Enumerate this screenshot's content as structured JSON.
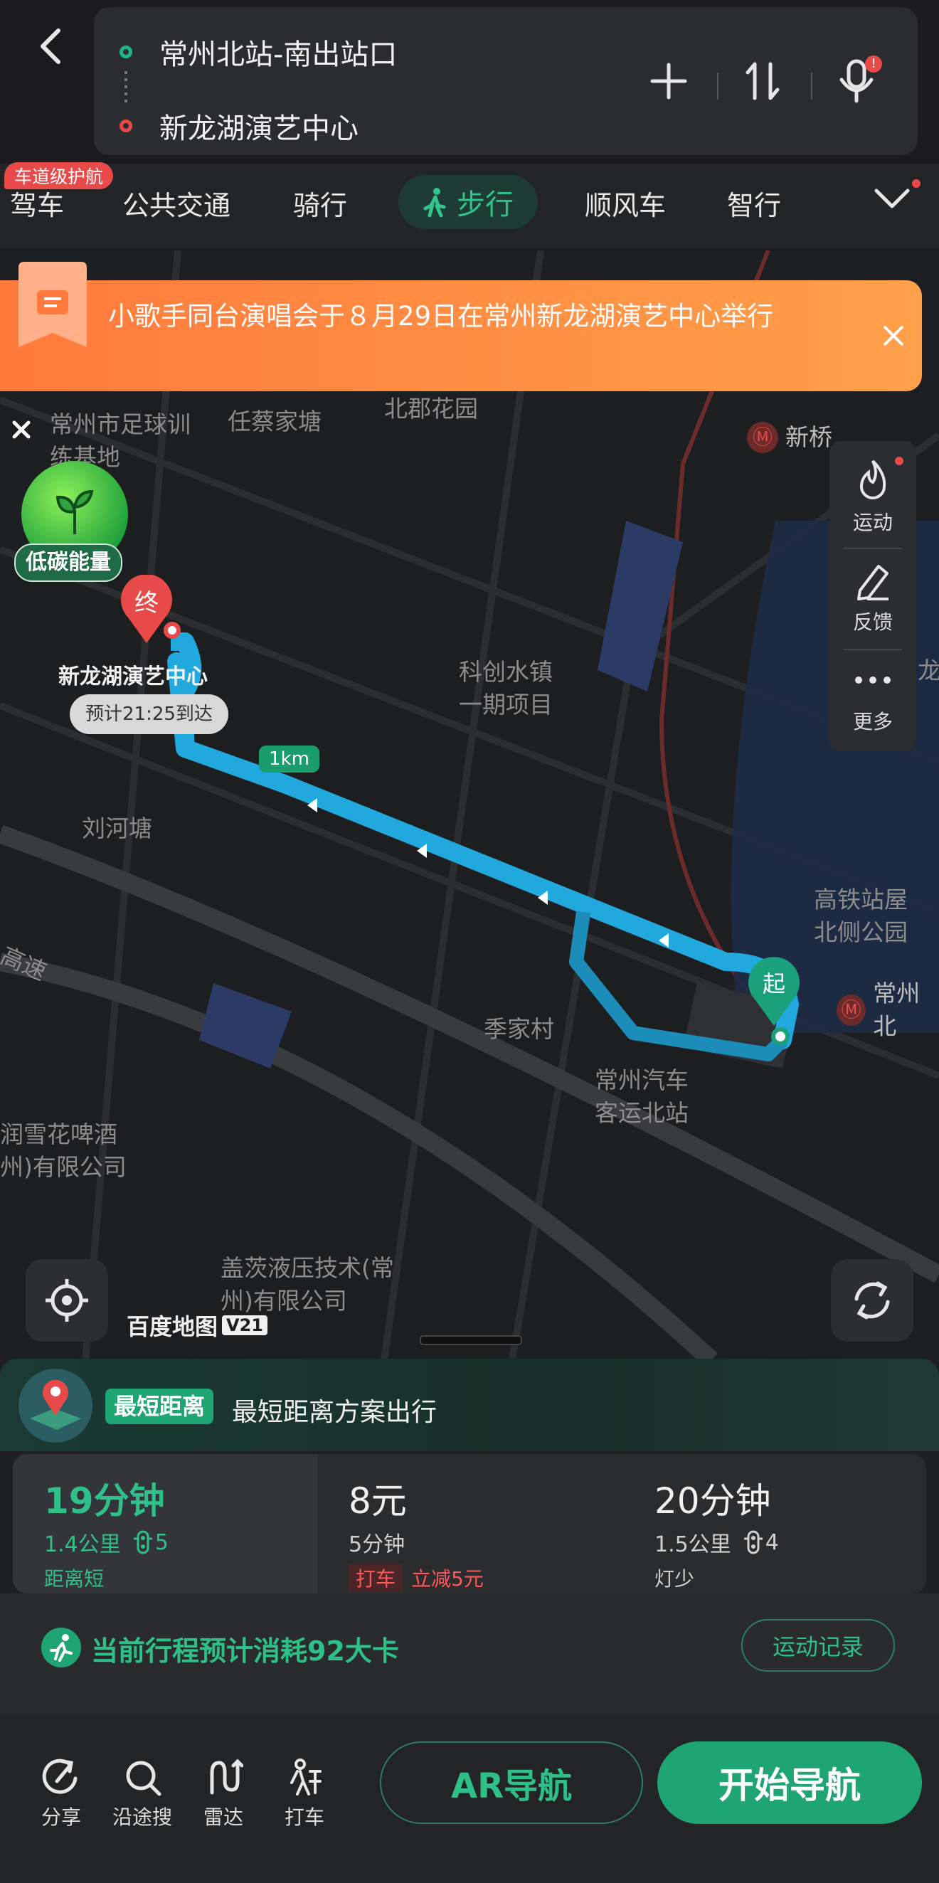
{
  "route": {
    "origin": "常州北站-南出站口",
    "destination": "新龙湖演艺中心",
    "add_icon": "plus-icon",
    "swap_icon": "swap-icon",
    "voice_icon": "mic-icon",
    "voice_badge": "!"
  },
  "modes": {
    "badge": "车道级护航",
    "items": [
      "驾车",
      "公共交通",
      "骑行",
      "步行",
      "顺风车",
      "智行"
    ],
    "active": "步行",
    "colors": {
      "active": "#30c58d"
    }
  },
  "notice": {
    "text": "小歌手同台演唱会于８月29日在常州新龙湖演艺中心举行"
  },
  "map": {
    "labels": {
      "l1": "常州市足球训练基地",
      "l2": "任蔡家塘",
      "l3": "北郡花园",
      "l4": "新桥",
      "l5": "科创水镇一期项目",
      "l6": "刘河塘",
      "l7": "高铁站屋北侧公园",
      "l8": "常州北",
      "l9": "季家村",
      "l10": "常州汽车客运北站",
      "l11": "润雪花啤酒州)有限公司",
      "l12": "盖茨液压技术(常州)有限公司",
      "l13": "高速",
      "l14": "龙"
    },
    "end_marker": "终",
    "start_marker": "起",
    "dest_name": "新龙湖演艺中心",
    "eta": "预计21:25到达",
    "scale": "1km",
    "low_carbon": "低碳能量",
    "brand": "百度地图",
    "brand_version": "V21",
    "side": [
      {
        "icon": "flame-icon",
        "label": "运动"
      },
      {
        "icon": "pencil-icon",
        "label": "反馈"
      },
      {
        "icon": "more-icon",
        "label": "更多"
      }
    ],
    "colors": {
      "route": "#21a8dc",
      "notice": "#ff8a40"
    }
  },
  "plan_header": {
    "tag": "最短距离",
    "desc": "最短距离方案出行"
  },
  "plans": [
    {
      "time": "19分钟",
      "dist": "1.4公里",
      "lights": "5",
      "note": "距离短"
    },
    {
      "time": "8元",
      "dist": "5分钟",
      "tag": "打车",
      "promo": "立减5元"
    },
    {
      "time": "20分钟",
      "dist": "1.5公里",
      "lights": "4",
      "note": "灯少"
    }
  ],
  "calorie": {
    "text": "当前行程预计消耗92大卡",
    "button": "运动记录"
  },
  "toolbar": {
    "items": [
      {
        "icon": "share-icon",
        "label": "分享"
      },
      {
        "icon": "search-icon",
        "label": "沿途搜"
      },
      {
        "icon": "radar-icon",
        "label": "雷达"
      },
      {
        "icon": "taxi-icon",
        "label": "打车"
      }
    ],
    "ar": "AR导航",
    "start": "开始导航"
  }
}
